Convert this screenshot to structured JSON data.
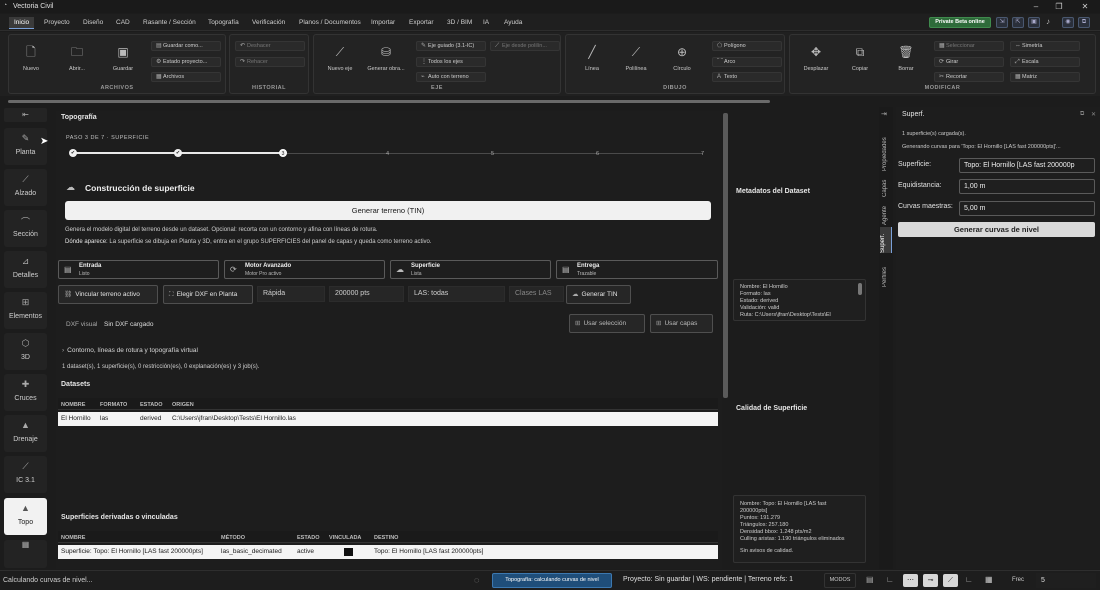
{
  "app": {
    "title": "Vectoria Civil"
  },
  "menu": {
    "items": [
      "Inicio",
      "Proyecto",
      "Diseño",
      "CAD",
      "Rasante / Sección",
      "Topografía",
      "Verificación",
      "Planos / Documentos",
      "Importar",
      "Exportar",
      "3D / BIM",
      "IA",
      "Ayuda"
    ],
    "beta": "Private Beta online"
  },
  "ribbon": {
    "archivos": {
      "label": "ARCHIVOS",
      "nuevo": "Nuevo",
      "abrir": "Abrir...",
      "guardar": "Guardar",
      "guardar_como": "Guardar como...",
      "estado_proyecto": "Estado proyecto...",
      "archivos": "Archivos"
    },
    "historial": {
      "label": "HISTORIAL",
      "deshacer": "Deshacer",
      "rehacer": "Rehacer"
    },
    "eje": {
      "label": "EJE",
      "nuevo_eje": "Nuevo eje",
      "generar_obra": "Generar obra...",
      "eje_guiado": "Eje guiado (3.1-IC)",
      "todos_ejes": "Todos los ejes",
      "auto_terreno": "Auto con terreno",
      "eje_polilinea": "Eje desde polilín..."
    },
    "dibujo": {
      "label": "DIBUJO",
      "linea": "Línea",
      "polilinea": "Polilínea",
      "circulo": "Círculo",
      "poligono": "Polígono",
      "arco": "Arco",
      "texto": "Texto"
    },
    "modificar": {
      "label": "MODIFICAR",
      "desplazar": "Desplazar",
      "copiar": "Copiar",
      "borrar": "Borrar",
      "seleccionar": "Seleccionar",
      "girar": "Girar",
      "recortar": "Recortar",
      "simetria": "Simetría",
      "escala": "Escala",
      "matriz": "Matriz"
    }
  },
  "sidebar": {
    "items": [
      {
        "label": "Planta",
        "icon": "plan-icon"
      },
      {
        "label": "Alzado",
        "icon": "profile-icon"
      },
      {
        "label": "Sección",
        "icon": "section-icon"
      },
      {
        "label": "Detalles",
        "icon": "details-icon"
      },
      {
        "label": "Elementos",
        "icon": "elements-icon"
      },
      {
        "label": "3D",
        "icon": "cube-icon"
      },
      {
        "label": "Cruces",
        "icon": "cross-icon"
      },
      {
        "label": "Drenaje",
        "icon": "drain-icon"
      },
      {
        "label": "IC 3.1",
        "icon": "ic-icon"
      },
      {
        "label": "Topo",
        "icon": "topo-icon"
      }
    ]
  },
  "main": {
    "title": "Topografía",
    "wizard": {
      "step": "PASO 3 DE 7 · SUPERFICIE",
      "current_num": "3",
      "nums": [
        "4",
        "5",
        "6",
        "7"
      ]
    },
    "section_title": "Construcción de superficie",
    "generate_btn": "Generar terreno (TIN)",
    "desc": "Genera el modelo digital del terreno desde un dataset. Opcional: recorta con un contorno y afina con líneas de rotura.",
    "where_label": "Dónde aparece:",
    "where_text": " La superficie se dibuja en Planta y 3D, entra en el grupo SUPERFICIES del panel de capas y queda como terreno activo.",
    "cards": [
      {
        "title": "Entrada",
        "sub": "Listo"
      },
      {
        "title": "Motor Avanzado",
        "sub": "Motor Pro activo"
      },
      {
        "title": "Superficie",
        "sub": "Lista"
      },
      {
        "title": "Entrega",
        "sub": "Trazable"
      }
    ],
    "actions": {
      "vincular": "Vincular terreno activo",
      "elegir_dxf": "Elegir DXF en Planta",
      "rapida": "Rápida",
      "pts": "200000 pts",
      "las": "LAS: todas",
      "clases": "Clases LAS",
      "generar_tin": "Generar TIN"
    },
    "dxf_label": "DXF visual",
    "dxf_value": "Sin DXF cargado",
    "usar_seleccion": "Usar selección",
    "usar_capas": "Usar capas",
    "contorno": "Contorno, líneas de rotura y topografía virtual",
    "summary": "1 dataset(s), 1 superficie(s), 0 restricción(es), 0 explanación(es) y 3 job(s).",
    "datasets": {
      "title": "Datasets",
      "headers": [
        "NOMBRE",
        "FORMATO",
        "ESTADO",
        "ORIGEN"
      ],
      "rows": [
        [
          "El Hornillo",
          "las",
          "derived",
          "C:\\Users\\jfran\\Desktop\\Tests\\El Hornillo.las"
        ]
      ]
    },
    "surfaces": {
      "title": "Superficies derivadas o vinculadas",
      "headers": [
        "NOMBRE",
        "MÉTODO",
        "ESTADO",
        "VINCULADA",
        "DESTINO"
      ],
      "rows": [
        [
          "Superficie: Topo: El Hornillo [LAS fast 200000pts]",
          "las_basic_decimated",
          "active",
          "",
          "Topo: El Hornillo [LAS fast 200000pts]"
        ]
      ]
    }
  },
  "middle": {
    "metadata_title": "Metadatos del Dataset",
    "metadata_lines": [
      "Nombre: El Hornillo",
      "Formato: las",
      "Estado: derived",
      "Validación: valid",
      "Ruta: C:\\Users\\jfran\\Desktop\\Tests\\El"
    ],
    "quality_title": "Calidad de Superficie",
    "quality_lines": [
      "Nombre: Topo: El Hornillo [LAS fast",
      "200000pts]",
      "Puntos: 191.279",
      "Triángulos: 257.180",
      "Densidad bbox: 1.248 pts/m2",
      "Culling aristas: 1.190 triángulos eliminados",
      "",
      "Sin avisos de calidad."
    ]
  },
  "right": {
    "title": "Superf.",
    "vtabs": [
      "Propiedades",
      "Capas",
      "Agente",
      "Superf.",
      "Perfiles"
    ],
    "log1": "1 superficie(s) cargada(s).",
    "log2": "Generando curvas para 'Topo: El Hornillo [LAS fast 200000pts]'...",
    "superficie_label": "Superficie:",
    "superficie_value": "Topo: El Hornillo [LAS fast 200000p",
    "equidistancia_label": "Equidistancia:",
    "equidistancia_value": "1,00 m",
    "curvas_label": "Curvas maestras:",
    "curvas_value": "5,00 m",
    "generate_btn": "Generar curvas de nivel"
  },
  "status": {
    "left": "Calculando curvas de nivel...",
    "badge": "Topografía: calculando curvas de nivel",
    "project": "Proyecto: Sin guardar | WS: pendiente | Terreno refs: 1",
    "modes": "MODOS",
    "frec_label": "Frec",
    "frec_value": "5"
  },
  "colors": {
    "accent": "#7aa0d8",
    "beta": "#2e6b3a",
    "badge": "#1f4e7a"
  }
}
